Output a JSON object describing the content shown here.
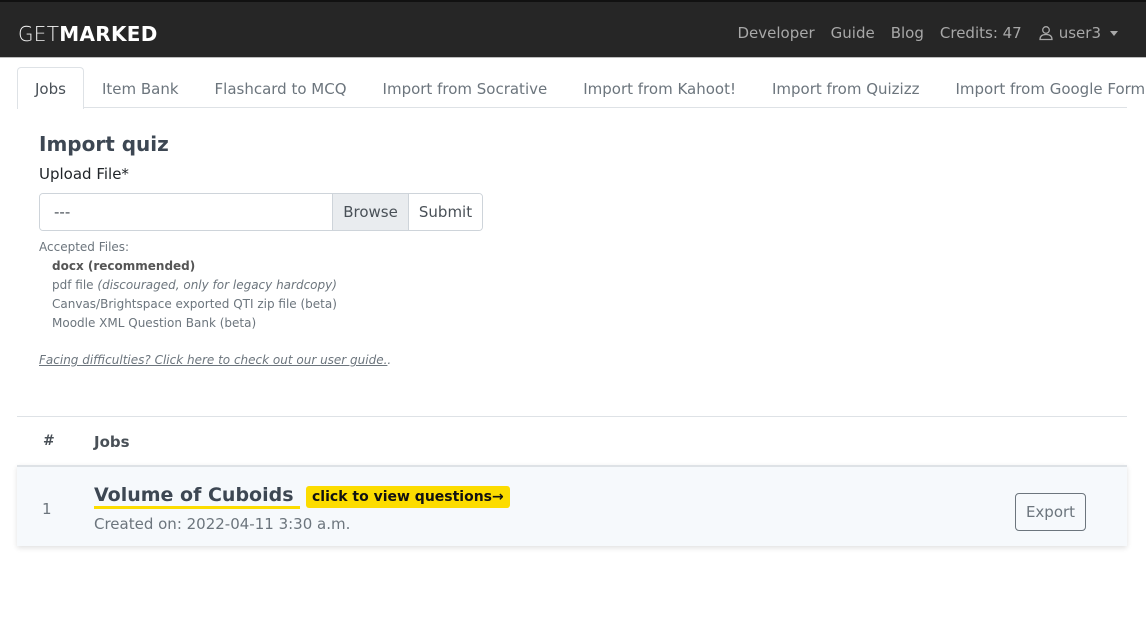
{
  "navbar": {
    "brand_light": "GET",
    "brand_bold": "MARKED",
    "links": [
      "Developer",
      "Guide",
      "Blog"
    ],
    "credits": "Credits: 47",
    "user": "user3",
    "user_icon": "user-outline-icon"
  },
  "tabs": [
    {
      "label": "Jobs",
      "active": true
    },
    {
      "label": "Item Bank",
      "active": false
    },
    {
      "label": "Flashcard to MCQ",
      "active": false
    },
    {
      "label": "Import from Socrative",
      "active": false
    },
    {
      "label": "Import from Kahoot!",
      "active": false
    },
    {
      "label": "Import from Quizizz",
      "active": false
    },
    {
      "label": "Import from Google Form",
      "active": false
    }
  ],
  "import": {
    "title": "Import quiz",
    "upload_label": "Upload File*",
    "file_value": "---",
    "browse_label": "Browse",
    "submit_label": "Submit",
    "accepted_heading": "Accepted Files:",
    "accepted": {
      "docx": "docx (recommended)",
      "pdf": "pdf file",
      "pdf_note": "(discouraged, only for legacy hardcopy)",
      "qti": "Canvas/Brightspace exported QTI zip file (beta)",
      "moodle": "Moodle XML Question Bank (beta)"
    },
    "help_link": "Facing difficulties? Click here to check out our user guide.",
    "help_suffix": "."
  },
  "jobs_table": {
    "headers": [
      "#",
      "Jobs"
    ],
    "rows": [
      {
        "index": "1",
        "title": "Volume of Cuboids",
        "badge": "click to view questions→",
        "created": "Created on: 2022-04-11 3:30 a.m.",
        "action": "Export"
      }
    ]
  },
  "colors": {
    "navbar_bg": "#262626",
    "accent_yellow": "#fcdc00",
    "heading": "#3d4753"
  }
}
